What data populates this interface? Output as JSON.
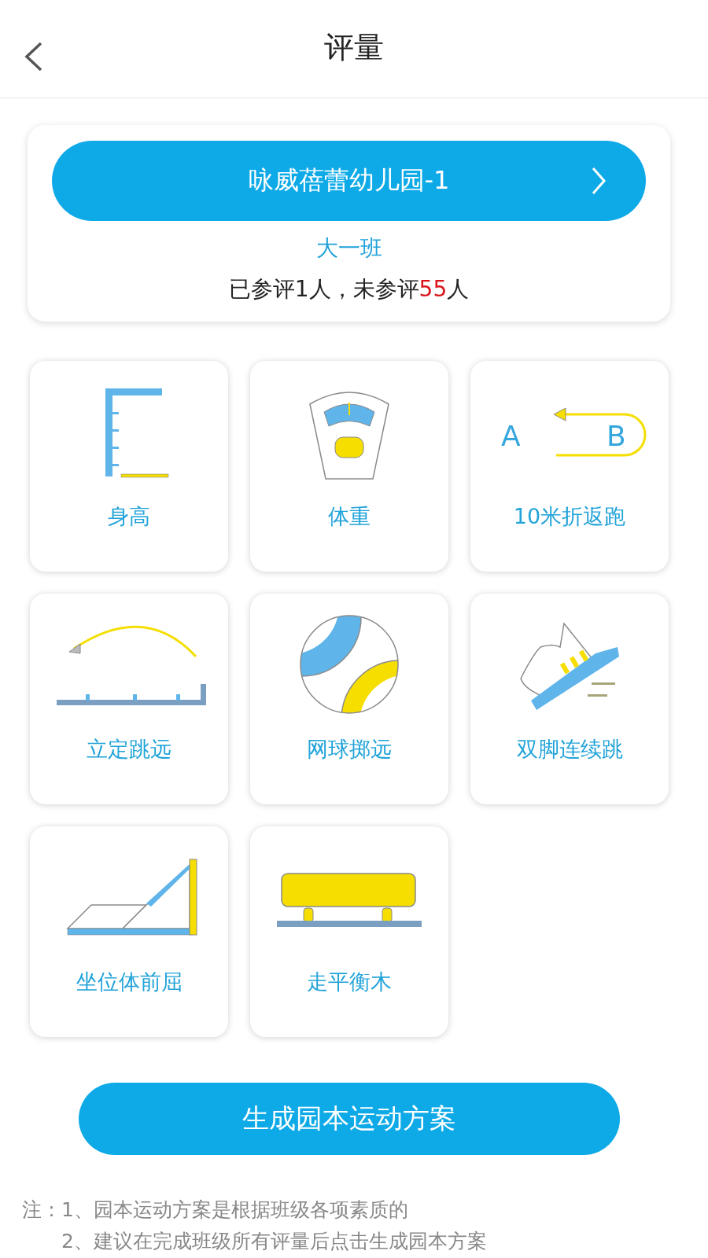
{
  "header": {
    "title": "评量"
  },
  "school": {
    "name": "咏威蓓蕾幼儿园-1",
    "class_name": "大一班",
    "status": {
      "prefix": "已参评1人，未参评",
      "pending": "55",
      "suffix": "人"
    }
  },
  "items": [
    {
      "label": "身高",
      "kind": "height"
    },
    {
      "label": "体重",
      "kind": "scale"
    },
    {
      "label": "10米折返跑",
      "kind": "shuttle",
      "marks": [
        "A",
        "B"
      ]
    },
    {
      "label": "立定跳远",
      "kind": "jump"
    },
    {
      "label": "网球掷远",
      "kind": "ball"
    },
    {
      "label": "双脚连续跳",
      "kind": "shoe"
    },
    {
      "label": "坐位体前屈",
      "kind": "reach"
    },
    {
      "label": "走平衡木",
      "kind": "beam"
    }
  ],
  "action_button": "生成园本运动方案",
  "notes": [
    "注：1、园本运动方案是根据班级各项素质的",
    "2、建议在完成班级所有评量后点击生成园本方案"
  ]
}
